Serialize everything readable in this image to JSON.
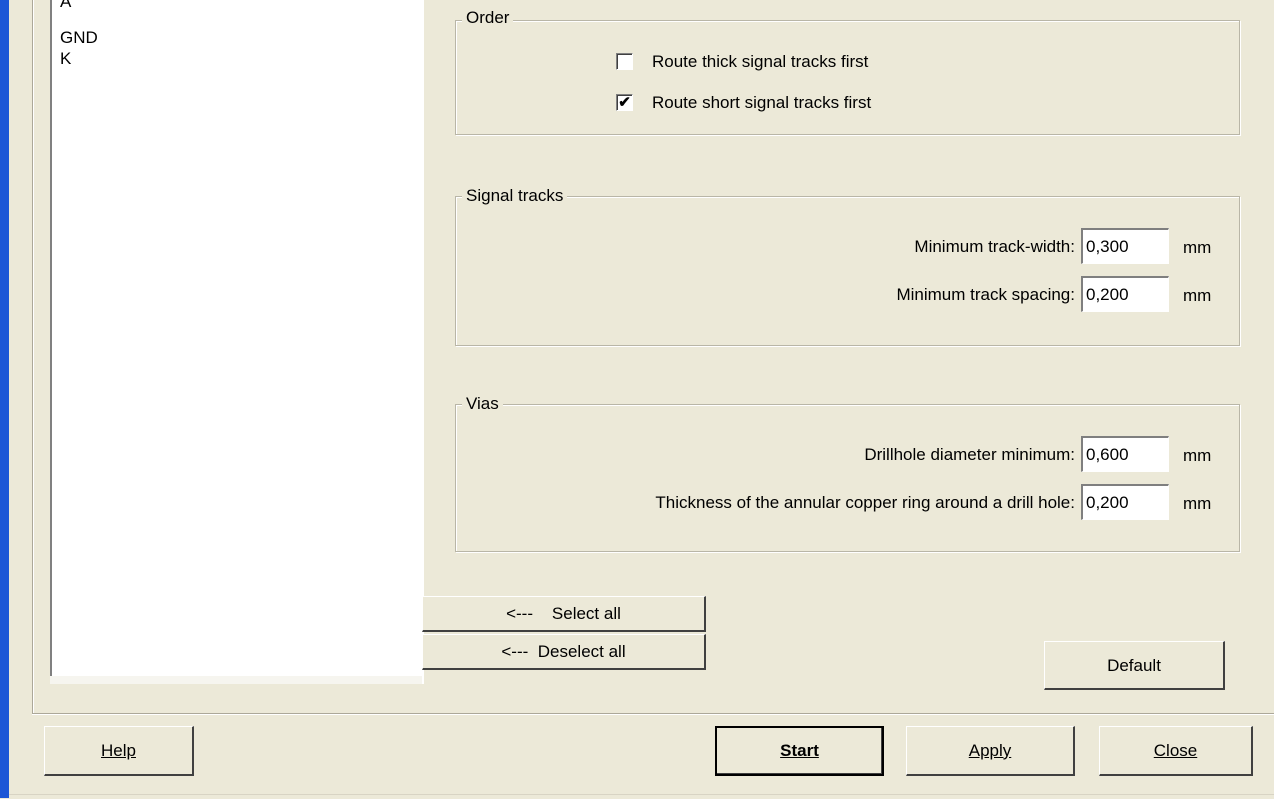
{
  "net_list": {
    "items": [
      "A",
      "GND",
      "K"
    ]
  },
  "order": {
    "legend": "Order",
    "route_thick": {
      "label": "Route thick signal tracks first",
      "checked": false
    },
    "route_short": {
      "label": "Route short signal tracks first",
      "checked": true
    }
  },
  "signal_tracks": {
    "legend": "Signal tracks",
    "min_width": {
      "label": "Minimum track-width:",
      "value": "0,300",
      "unit": "mm"
    },
    "min_spacing": {
      "label": "Minimum track spacing:",
      "value": "0,200",
      "unit": "mm"
    }
  },
  "vias": {
    "legend": "Vias",
    "drill_min": {
      "label": "Drillhole diameter minimum:",
      "value": "0,600",
      "unit": "mm"
    },
    "ring_thickness": {
      "label": "Thickness of the annular copper ring around a drill hole:",
      "value": "0,200",
      "unit": "mm"
    }
  },
  "selection": {
    "select_all": "<---    Select all",
    "deselect_all": "<---  Deselect all"
  },
  "buttons": {
    "default": "Default",
    "help": "Help",
    "start": "Start",
    "apply": "Apply",
    "close": "Close"
  },
  "checkmark_glyph": "✔"
}
